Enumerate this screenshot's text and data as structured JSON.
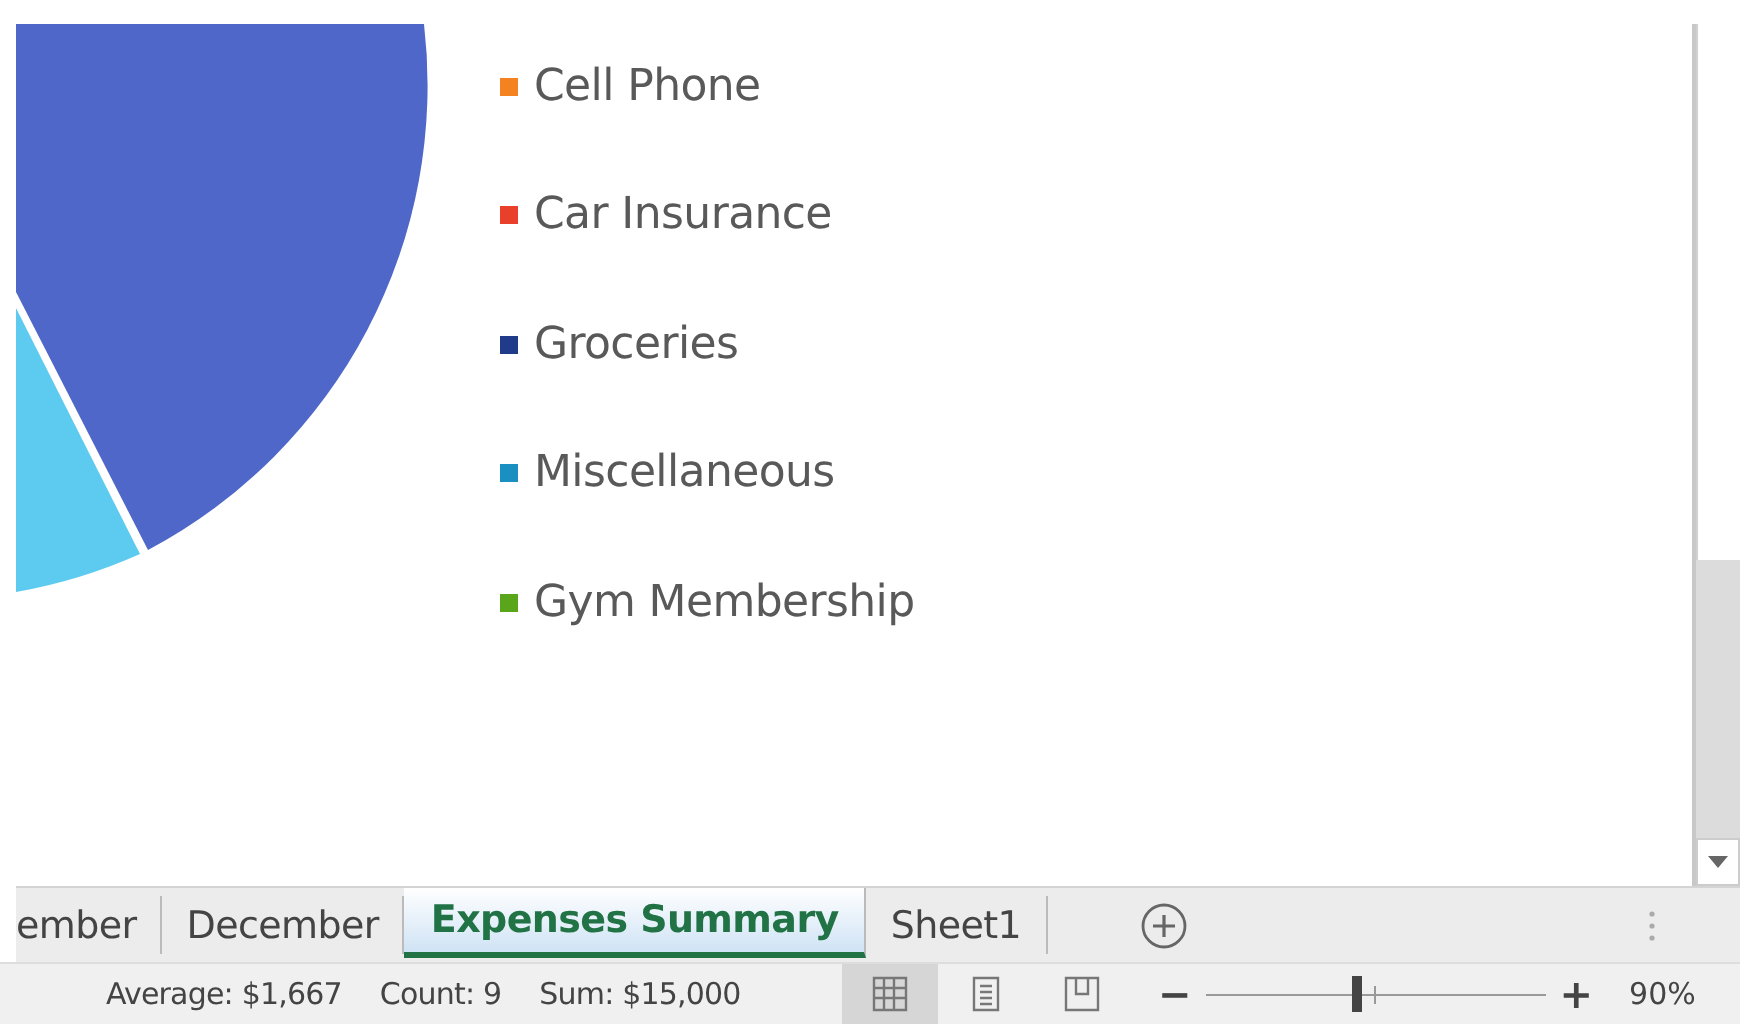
{
  "legend": [
    {
      "label": "Cell Phone",
      "color": "#f58220"
    },
    {
      "label": "Car Insurance",
      "color": "#e8402a"
    },
    {
      "label": "Groceries",
      "color": "#1f3b8a"
    },
    {
      "label": "Miscellaneous",
      "color": "#1a8fc2"
    },
    {
      "label": "Gym Membership",
      "color": "#5aa61a"
    }
  ],
  "sheet_tabs": [
    {
      "label": "ember",
      "selected": false
    },
    {
      "label": "December",
      "selected": false
    },
    {
      "label": "Expenses Summary",
      "selected": true
    },
    {
      "label": "Sheet1",
      "selected": false
    }
  ],
  "status_bar": {
    "stats": [
      "Average: $1,667",
      "Count: 9",
      "Sum: $15,000"
    ],
    "views": [
      {
        "kind": "normal",
        "selected": true
      },
      {
        "kind": "page-layout",
        "selected": false
      },
      {
        "kind": "page-break",
        "selected": false
      }
    ],
    "zoom_out": "−",
    "zoom_in": "+",
    "zoom": {
      "level": 0.44
    },
    "zoom_reading": "90%"
  }
}
